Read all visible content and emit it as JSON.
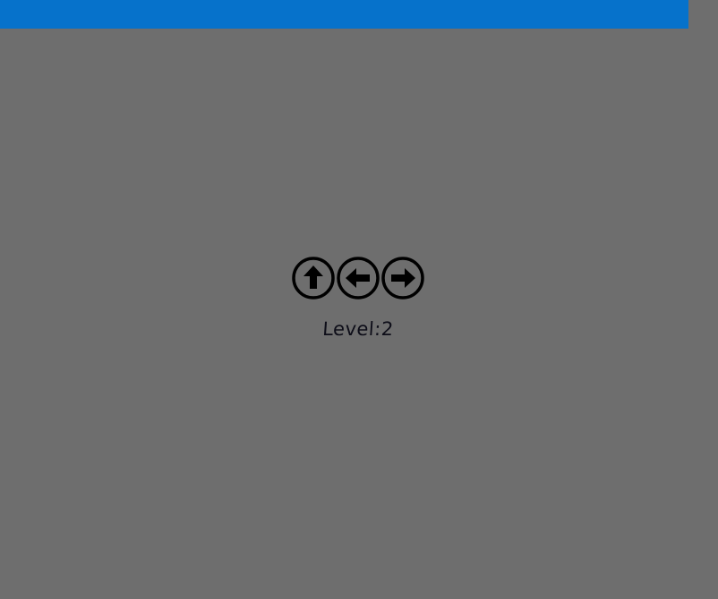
{
  "header": {
    "bar_color": "#0672cb"
  },
  "background_color": "#6e6e6e",
  "controls": {
    "buttons": [
      {
        "direction": "up",
        "icon": "arrow-up-circle-icon"
      },
      {
        "direction": "left",
        "icon": "arrow-left-circle-icon"
      },
      {
        "direction": "right",
        "icon": "arrow-right-circle-icon"
      }
    ]
  },
  "level": {
    "text": "Level:2"
  }
}
